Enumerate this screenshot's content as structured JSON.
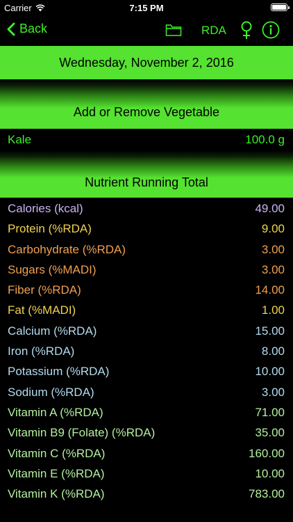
{
  "status_bar": {
    "carrier": "Carrier",
    "time": "7:15 PM"
  },
  "nav": {
    "back_label": "Back",
    "rda_label": "RDA"
  },
  "date": "Wednesday, November 2, 2016",
  "add_remove_label": "Add or Remove Vegetable",
  "vegetable": {
    "name": "Kale",
    "quantity": "100.0 g"
  },
  "running_total_label": "Nutrient Running Total",
  "nutrients": [
    {
      "label": "Calories (kcal)",
      "value": "49.00",
      "color": "#c8b4f0"
    },
    {
      "label": "Protein (%RDA)",
      "value": "9.00",
      "color": "#f0d250"
    },
    {
      "label": "Carbohydrate (%RDA)",
      "value": "3.00",
      "color": "#f0a050"
    },
    {
      "label": "Sugars (%MADI)",
      "value": "3.00",
      "color": "#f0a050"
    },
    {
      "label": "Fiber (%RDA)",
      "value": "14.00",
      "color": "#f0a050"
    },
    {
      "label": "Fat (%MADI)",
      "value": "1.00",
      "color": "#f0d250"
    },
    {
      "label": "Calcium (%RDA)",
      "value": "15.00",
      "color": "#b4dcf0"
    },
    {
      "label": "Iron (%RDA)",
      "value": "8.00",
      "color": "#b4dcf0"
    },
    {
      "label": "Potassium (%RDA)",
      "value": "10.00",
      "color": "#b4dcf0"
    },
    {
      "label": "Sodium (%RDA)",
      "value": "3.00",
      "color": "#b4dcf0"
    },
    {
      "label": "Vitamin A (%RDA)",
      "value": "71.00",
      "color": "#b4f0a0"
    },
    {
      "label": "Vitamin B9 (Folate) (%RDA)",
      "value": "35.00",
      "color": "#b4f0a0"
    },
    {
      "label": "Vitamin C (%RDA)",
      "value": "160.00",
      "color": "#b4f0a0"
    },
    {
      "label": "Vitamin E (%RDA)",
      "value": "10.00",
      "color": "#b4f0a0"
    },
    {
      "label": "Vitamin K (%RDA)",
      "value": "783.00",
      "color": "#b4f0a0"
    }
  ],
  "colors": {
    "accent": "#3cf026",
    "bar": "#55e230"
  }
}
